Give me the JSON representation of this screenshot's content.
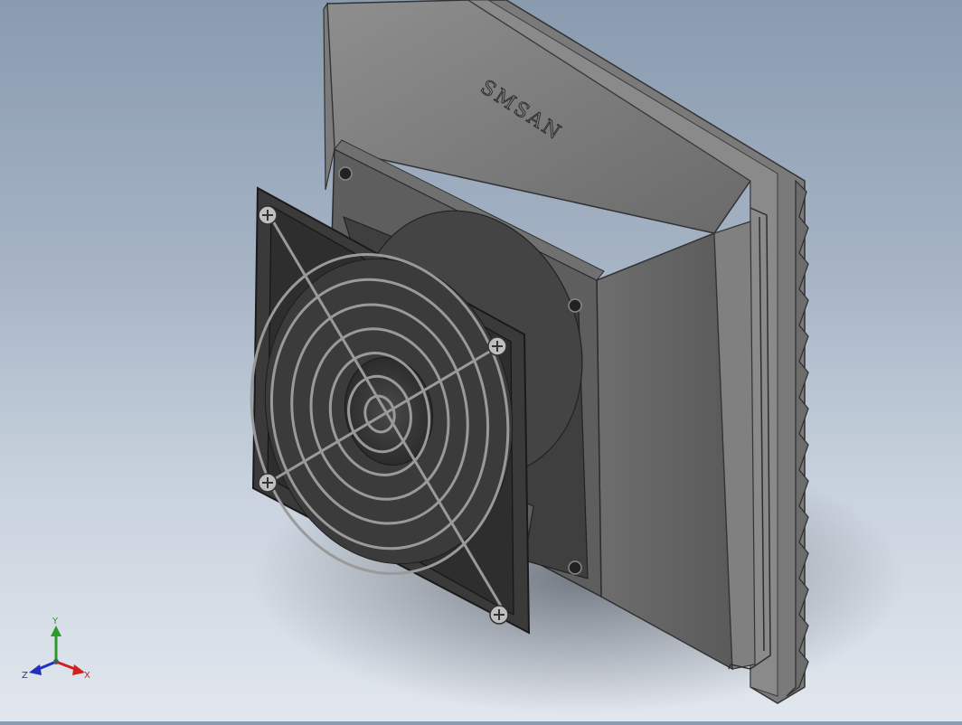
{
  "model": {
    "brand_text": "SMSAN",
    "description": "filter-fan-assembly"
  },
  "triad": {
    "x_label": "X",
    "y_label": "Y",
    "z_label": "Z",
    "x_color": "#d12020",
    "y_color": "#2a9a2a",
    "z_color": "#2030c0"
  }
}
